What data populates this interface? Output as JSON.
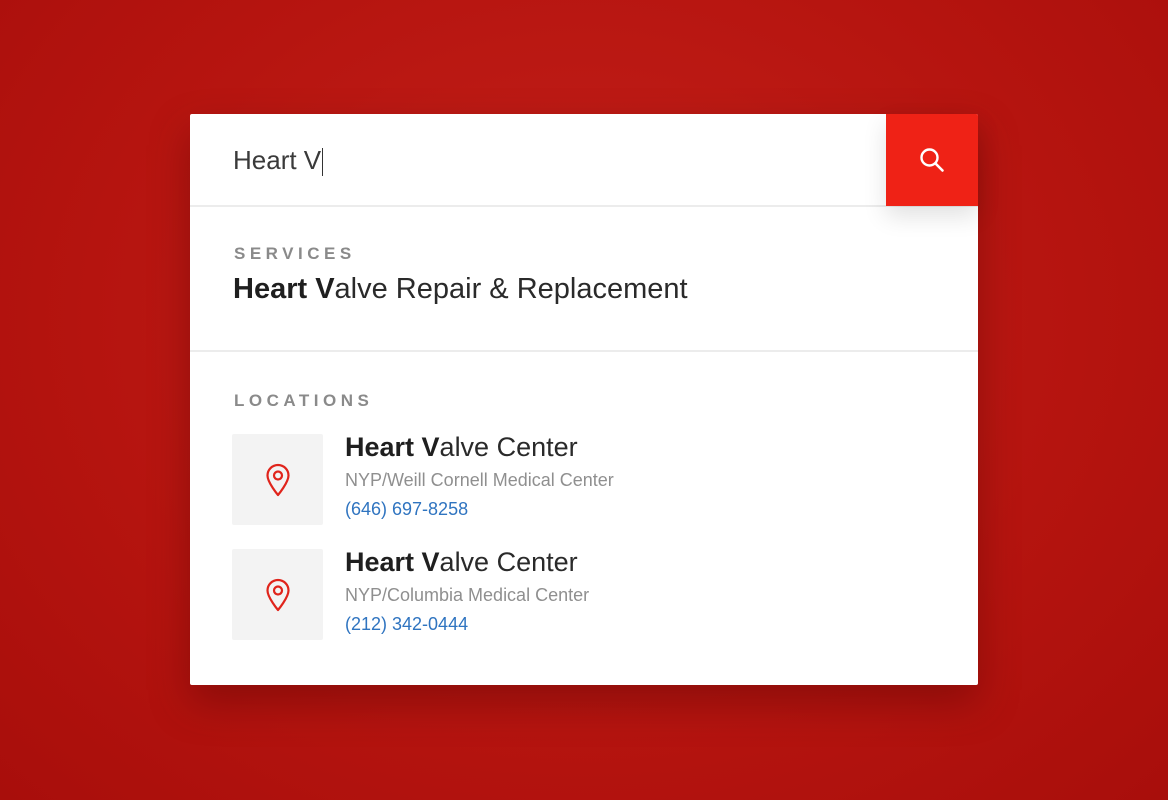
{
  "search": {
    "value": "Heart V",
    "button_icon": "search-icon"
  },
  "services": {
    "label": "SERVICES",
    "items": [
      {
        "match": "Heart V",
        "rest": "alve Repair & Replacement"
      }
    ]
  },
  "locations": {
    "label": "LOCATIONS",
    "items": [
      {
        "icon": "map-pin-icon",
        "match": "Heart V",
        "rest": "alve Center",
        "subtitle": "NYP/Weill Cornell Medical Center",
        "phone": "(646) 697-8258"
      },
      {
        "icon": "map-pin-icon",
        "match": "Heart V",
        "rest": "alve Center",
        "subtitle": "NYP/Columbia Medical Center",
        "phone": "(212) 342-0444"
      }
    ]
  },
  "colors": {
    "background": "#b5140f",
    "accent": "#ef2216",
    "link": "#2f74c0",
    "pin": "#e0241b"
  }
}
